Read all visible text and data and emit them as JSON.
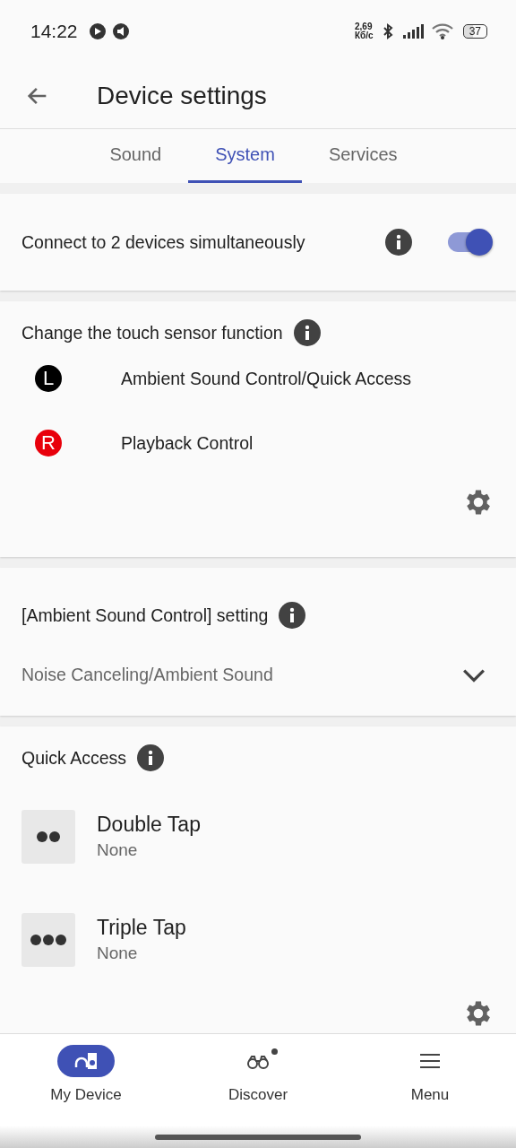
{
  "status_bar": {
    "time": "14:22",
    "net_speed": "2,69",
    "net_unit": "Кб/с",
    "battery": "37"
  },
  "header": {
    "title": "Device settings"
  },
  "tabs": [
    {
      "label": "Sound",
      "selected": false
    },
    {
      "label": "System",
      "selected": true
    },
    {
      "label": "Services",
      "selected": false
    }
  ],
  "dual_connect": {
    "label": "Connect to 2 devices simultaneously",
    "on": true
  },
  "touch_sensor": {
    "title": "Change the touch sensor function",
    "sides": [
      {
        "badge": "L",
        "color": "#000000",
        "function": "Ambient Sound Control/Quick Access"
      },
      {
        "badge": "R",
        "color": "#e8000b",
        "function": "Playback Control"
      }
    ]
  },
  "ambient_setting": {
    "title": "[Ambient Sound Control] setting",
    "value": "Noise Canceling/Ambient Sound"
  },
  "quick_access": {
    "title": "Quick Access",
    "items": [
      {
        "kind": "double",
        "name": "Double Tap",
        "value": "None"
      },
      {
        "kind": "triple",
        "name": "Triple Tap",
        "value": "None"
      }
    ]
  },
  "bottom_nav": [
    {
      "kind": "device",
      "label": "My Device",
      "selected": true,
      "notification": false
    },
    {
      "kind": "discover",
      "label": "Discover",
      "selected": false,
      "notification": true
    },
    {
      "kind": "menu",
      "label": "Menu",
      "selected": false,
      "notification": false
    }
  ]
}
